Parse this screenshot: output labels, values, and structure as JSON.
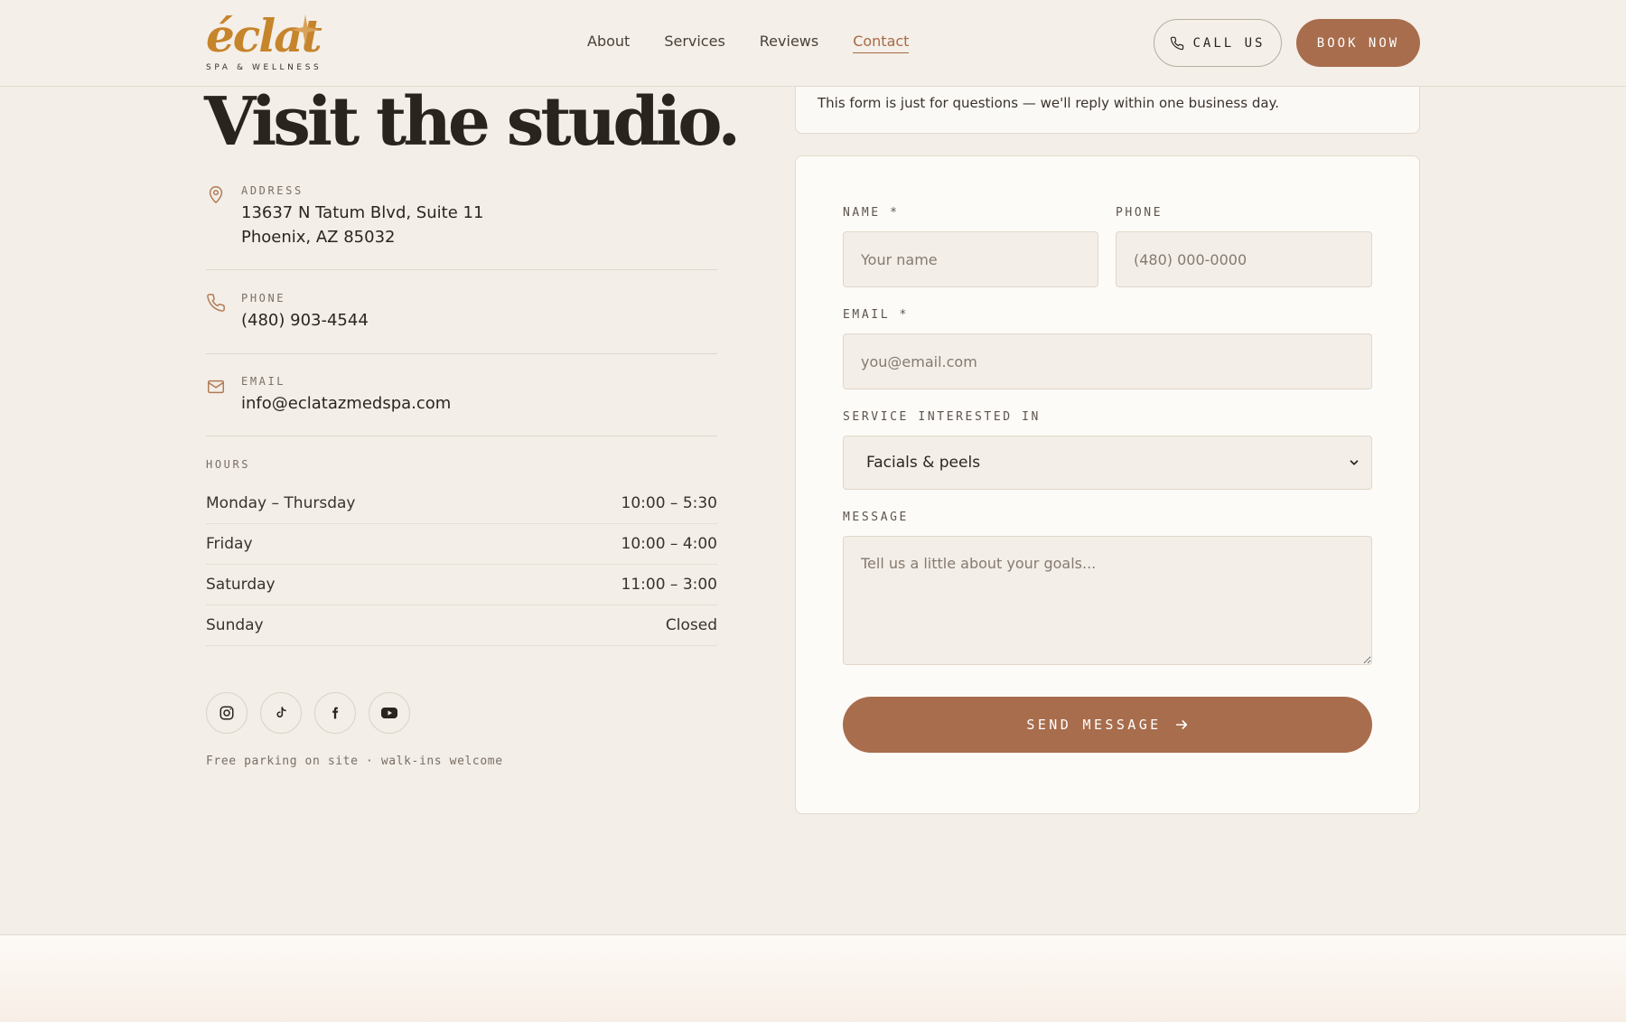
{
  "brand": {
    "name": "éclat",
    "tagline": "SPA & WELLNESS",
    "accent": "#a86d4c",
    "logo_color": "#c6842b"
  },
  "nav": {
    "links": [
      {
        "label": "About"
      },
      {
        "label": "Services"
      },
      {
        "label": "Reviews"
      },
      {
        "label": "Contact",
        "active": true
      }
    ],
    "call_label": "CALL US",
    "book_label": "BOOK NOW"
  },
  "contact": {
    "heading": "Visit the studio.",
    "address": {
      "label": "ADDRESS",
      "line1": "13637 N Tatum Blvd, Suite 11",
      "line2": "Phoenix, AZ 85032",
      "icon": "map-pin-icon"
    },
    "phone": {
      "label": "PHONE",
      "value": "(480) 903-4544",
      "icon": "phone-icon"
    },
    "email": {
      "label": "EMAIL",
      "value": "info@eclatazmedspa.com",
      "icon": "mail-icon"
    },
    "hours": {
      "label": "HOURS",
      "rows": [
        {
          "day": "Monday – Thursday",
          "time": "10:00 – 5:30"
        },
        {
          "day": "Friday",
          "time": "10:00 – 4:00"
        },
        {
          "day": "Saturday",
          "time": "11:00 – 3:00"
        },
        {
          "day": "Sunday",
          "time": "Closed"
        }
      ]
    },
    "socials": [
      "instagram-icon",
      "tiktok-icon",
      "facebook-icon",
      "youtube-icon"
    ],
    "footnote": "Free parking on site · walk-ins welcome"
  },
  "form": {
    "note": "This form is just for questions — we'll reply within one business day.",
    "name_label": "NAME *",
    "name_placeholder": "Your name",
    "phone_label": "PHONE",
    "phone_placeholder": "(480) 000-0000",
    "email_label": "EMAIL *",
    "email_placeholder": "you@email.com",
    "service_label": "SERVICE INTERESTED IN",
    "service_value": "Facials & peels",
    "message_label": "MESSAGE",
    "message_placeholder": "Tell us a little about your goals...",
    "submit_label": "SEND MESSAGE"
  }
}
